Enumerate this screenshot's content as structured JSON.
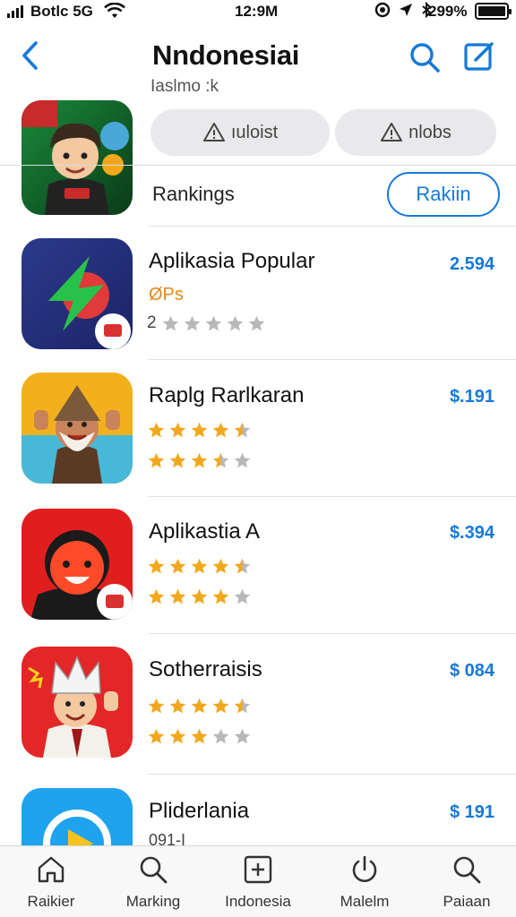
{
  "status_bar": {
    "carrier": "Botlc 5G",
    "time": "12:9M",
    "battery_pct": "299%"
  },
  "header": {
    "title": "Nndonesiai",
    "subtitle": "Iaslmo :k",
    "back_icon": "chevron-left-icon",
    "search_icon": "search-icon",
    "compose_icon": "compose-icon"
  },
  "filters": [
    {
      "label": "ıuloist",
      "icon": "warning-icon"
    },
    {
      "label": "nlobs",
      "icon": "warning-icon"
    }
  ],
  "rankings": {
    "label": "Rankings",
    "button_label": "Rakiin"
  },
  "apps": [
    {
      "name": "Aplikasia Popular",
      "price": "2.594",
      "meta": "ØPs",
      "rating_prefix": "2",
      "rating": 0,
      "rating2": null
    },
    {
      "name": "Raplg Rarlkaran",
      "price": "$.191",
      "meta": "",
      "rating_prefix": "",
      "rating": 4.5,
      "rating2": 3.5
    },
    {
      "name": "Aplikastia  A",
      "price": "$.394",
      "meta": "",
      "rating_prefix": "",
      "rating": 4.5,
      "rating2": 4
    },
    {
      "name": "Sotherraisis",
      "price": "$ 084",
      "meta": "",
      "rating_prefix": "",
      "rating": 4.5,
      "rating2": 3
    },
    {
      "name": "Pliderlania",
      "price": "$ 191",
      "meta": "091-I",
      "rating_prefix": "",
      "rating": null,
      "rating2": null
    }
  ],
  "tabs": [
    {
      "label": "Raikier",
      "icon": "home-icon"
    },
    {
      "label": "Marking",
      "icon": "search-icon"
    },
    {
      "label": "Indonesia",
      "icon": "plus-square-icon"
    },
    {
      "label": "Malelm",
      "icon": "power-icon"
    },
    {
      "label": "Paiaan",
      "icon": "search-icon"
    }
  ],
  "colors": {
    "accent": "#1679d8",
    "star_filled": "#f2a81d",
    "star_empty": "#b8b8b8"
  }
}
